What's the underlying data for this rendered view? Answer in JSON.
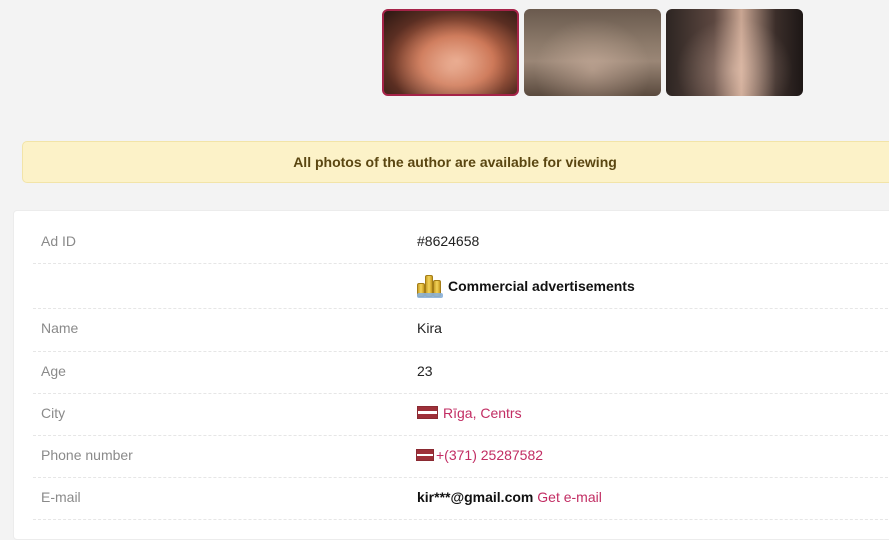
{
  "gallery": {
    "thumbnails": [
      {
        "label": "photo-1",
        "selected": true
      },
      {
        "label": "photo-2",
        "selected": false
      },
      {
        "label": "photo-3",
        "selected": false
      }
    ]
  },
  "notice": {
    "text": "All photos of the author are available for viewing"
  },
  "details": {
    "ad_id": {
      "label": "Ad ID",
      "value": "#8624658"
    },
    "category": {
      "value": "Commercial advertisements",
      "icon": "coins-icon"
    },
    "name": {
      "label": "Name",
      "value": "Kira"
    },
    "age": {
      "label": "Age",
      "value": "23"
    },
    "city": {
      "label": "City",
      "value": "Rīga, Centrs",
      "flag": "latvia-flag-icon"
    },
    "phone": {
      "label": "Phone number",
      "value": "+(371) 25287582",
      "flag": "latvia-flag-icon"
    },
    "email": {
      "label": "E-mail",
      "value": "kir***@gmail.com",
      "action": "Get e-mail"
    }
  },
  "colors": {
    "accent": "#c22d63",
    "notice_bg": "#fcf2c8",
    "notice_text": "#5a4611",
    "label": "#8a8a8a"
  }
}
